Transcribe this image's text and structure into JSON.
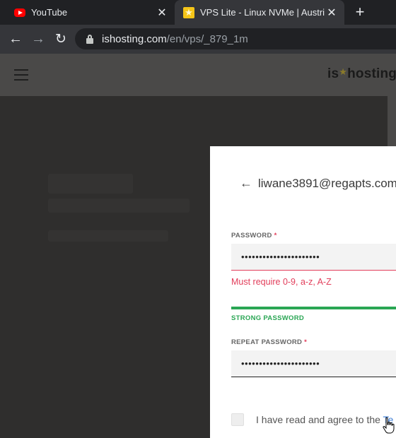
{
  "browser": {
    "tabs": [
      {
        "title": "YouTube",
        "favicon": "youtube-icon",
        "active": false
      },
      {
        "title": "VPS Lite - Linux NVMe | Austria | ",
        "favicon": "ishosting-star-icon",
        "active": true
      }
    ],
    "close_glyph": "✕",
    "new_tab_glyph": "+",
    "nav": {
      "back_glyph": "←",
      "forward_glyph": "→",
      "reload_glyph": "↻"
    },
    "url_host": "ishosting.com",
    "url_path": "/en/vps/_879_1m"
  },
  "site": {
    "logo_left": "is",
    "logo_star": "★",
    "logo_right": "hosting"
  },
  "form": {
    "back_glyph": "←",
    "email": "liwane3891@regapts.com",
    "password_label": "PASSWORD",
    "required_mark": "*",
    "password_value": "••••••••••••••••••••••",
    "password_error": "Must require 0-9, a-z, A-Z",
    "strength_label": "STRONG PASSWORD",
    "repeat_label": "REPEAT PASSWORD",
    "repeat_value": "••••••••••••••••••••••",
    "agree_text": "I have read and agree to the ",
    "agree_link": "Te"
  },
  "colors": {
    "error": "#e23d5a",
    "strong": "#2aa654",
    "link": "#3a7bd5",
    "youtube": "#ff0000",
    "logo_star": "#f5c518"
  }
}
